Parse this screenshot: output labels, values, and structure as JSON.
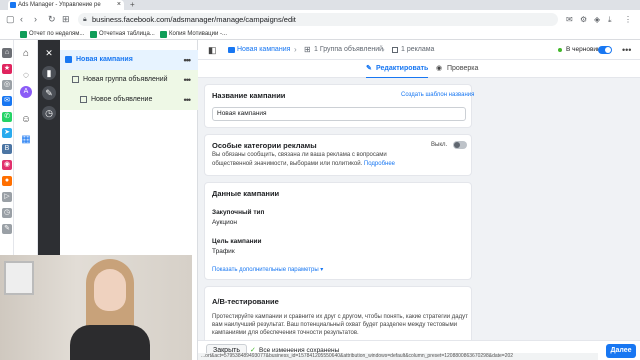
{
  "browser": {
    "tab_title": "Ads Manager - Управление ре",
    "new_tab": "+",
    "url": "business.facebook.com/adsmanager/manage/campaigns/edit",
    "bookmarks": [
      {
        "label": "Отчет по неделям...",
        "color": "#0f9d58"
      },
      {
        "label": "Отчетная таблица...",
        "color": "#0f9d58"
      },
      {
        "label": "Копия Мотивации -...",
        "color": "#0f9d58"
      }
    ]
  },
  "tree": {
    "campaign": "Новая кампания",
    "ad_group": "Новая группа объявлений",
    "ad": "Новое объявление",
    "more": "•••"
  },
  "header": {
    "crumb_campaign": "Новая кампания",
    "crumb_group": "1 Группа объявлений",
    "crumb_ad": "1 рекламa",
    "draft": "В черновике",
    "more": "•••"
  },
  "tabs": {
    "edit": "Редактировать",
    "preview": "Проверка"
  },
  "campaign_name": {
    "title": "Название кампании",
    "template_link": "Создать шаблон названия",
    "value": "Новая кампания"
  },
  "special_categories": {
    "title": "Особые категории рекламы",
    "toggle_label": "Выкл.",
    "desc1": "Вы обязаны сообщить, связана ли ваша реклама с вопросами",
    "desc2": "общественной значимости, выборами или политикой.",
    "more_link": "Подробнее"
  },
  "campaign_data": {
    "title": "Данные кампании",
    "purchase_label": "Закупочный тип",
    "purchase_value": "Аукцион",
    "objective_label": "Цель кампании",
    "objective_value": "Трафик",
    "more_params": "Показать дополнительные параметры ▾"
  },
  "ab_test": {
    "title": "A/B-тестирование",
    "desc": "Протестируйте кампании и сравните их друг с другом, чтобы понять, какие стратегии дадут вам наилучший результат. Ваш потенциальный охват будет разделен между тестовыми кампаниями для обеспечения точности результатов."
  },
  "footer": {
    "close": "Закрыть",
    "saved": "Все изменения сохранены",
    "next": "Далее"
  },
  "status_url": "...ort&act=579538489493077&business_id=157841205550640&attribution_windows=default&column_preset=1208800863670298&date=202"
}
